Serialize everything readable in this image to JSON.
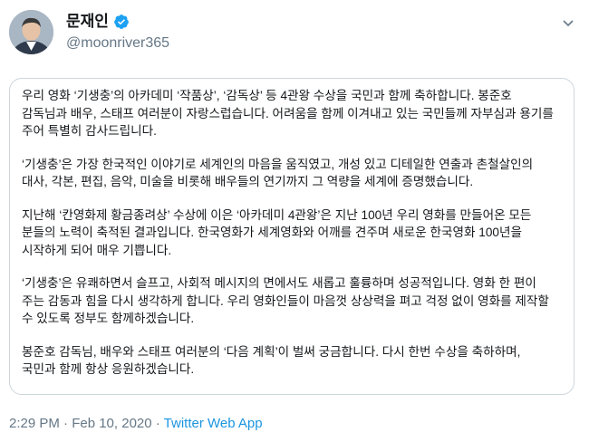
{
  "user": {
    "display_name": "문재인",
    "handle": "@moonriver365",
    "verified_icon": "verified-badge-icon",
    "verified_color": "#1da1f2"
  },
  "tweet": {
    "paragraphs": [
      "우리 영화 ‘기생충’의 아카데미 ‘작품상’, ‘감독상’ 등 4관왕 수상을 국민과 함께 축하합니다. 봉준호\n감독님과 배우, 스태프 여러분이 자랑스럽습니다. 어려움을 함께 이겨내고 있는 국민들께 자부심과 용기를\n주어 특별히 감사드립니다.",
      "‘기생충’은 가장 한국적인 이야기로 세계인의 마음을 움직였고, 개성 있고 디테일한 연출과 촌철살인의\n대사, 각본, 편집, 음악, 미술을 비롯해 배우들의 연기까지 그 역량을 세계에 증명했습니다.",
      "지난해 ‘칸영화제 황금종려상’ 수상에 이은 ‘아카데미 4관왕’은 지난 100년 우리 영화를 만들어온 모든\n분들의 노력이 축적된 결과입니다. 한국영화가 세계영화와 어깨를 견주며 새로운 한국영화 100년을\n시작하게 되어 매우 기쁩니다.",
      "‘기생충’은 유쾌하면서 슬프고, 사회적 메시지의 면에서도 새롭고 훌륭하며 성공적입니다. 영화 한 편이\n주는 감동과 힘을 다시 생각하게 합니다. 우리 영화인들이 마음껏 상상력을 펴고 걱정 없이 영화를 제작할\n수 있도록 정부도 함께하겠습니다.",
      "봉준호 감독님, 배우와 스태프 여러분의 ‘다음 계획’이 벌써 궁금합니다. 다시 한번 수상을 축하하며,\n국민과 함께 항상 응원하겠습니다."
    ]
  },
  "footer": {
    "timestamp": "2:29 PM · Feb 10, 2020 · ",
    "source": "Twitter Web App",
    "source_color": "#1b95e0"
  },
  "icons": {
    "caret": "chevron-down-icon",
    "avatar": "avatar"
  }
}
